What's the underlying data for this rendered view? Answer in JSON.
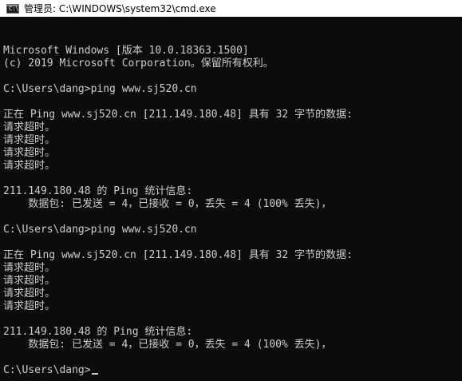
{
  "window": {
    "title": "管理员: C:\\WINDOWS\\system32\\cmd.exe",
    "icon": "cmd-icon",
    "icon_glyph": "C:\\"
  },
  "console": {
    "lines": [
      "Microsoft Windows [版本 10.0.18363.1500]",
      "(c) 2019 Microsoft Corporation。保留所有权利。",
      "",
      "C:\\Users\\dang>ping www.sj520.cn",
      "",
      "正在 Ping www.sj520.cn [211.149.180.48] 具有 32 字节的数据:",
      "请求超时。",
      "请求超时。",
      "请求超时。",
      "请求超时。",
      "",
      "211.149.180.48 的 Ping 统计信息:",
      "    数据包: 已发送 = 4，已接收 = 0，丢失 = 4 (100% 丢失)，",
      "",
      "C:\\Users\\dang>ping www.sj520.cn",
      "",
      "正在 Ping www.sj520.cn [211.149.180.48] 具有 32 字节的数据:",
      "请求超时。",
      "请求超时。",
      "请求超时。",
      "请求超时。",
      "",
      "211.149.180.48 的 Ping 统计信息:",
      "    数据包: 已发送 = 4，已接收 = 0，丢失 = 4 (100% 丢失)，",
      ""
    ],
    "prompt": "C:\\Users\\dang>"
  }
}
